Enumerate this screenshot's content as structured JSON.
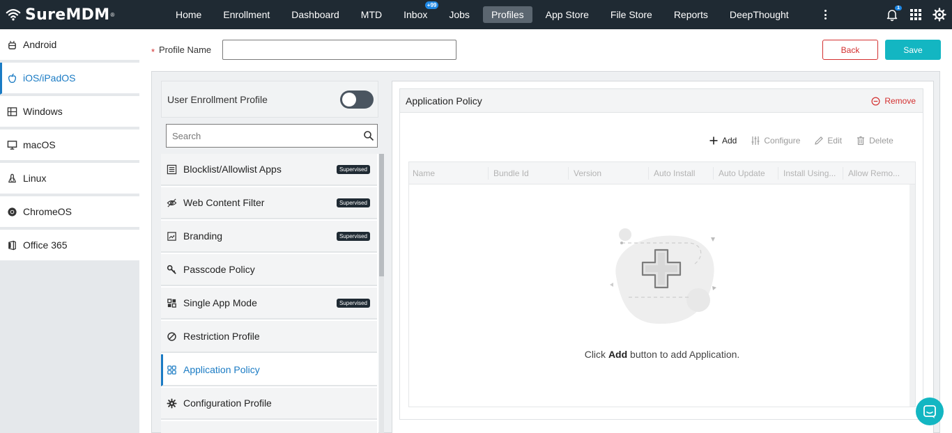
{
  "app": {
    "logo": "SureMDM",
    "logo_mark": "®"
  },
  "nav": {
    "items": [
      {
        "label": "Home"
      },
      {
        "label": "Enrollment"
      },
      {
        "label": "Dashboard"
      },
      {
        "label": "MTD"
      },
      {
        "label": "Inbox",
        "badge": "+99"
      },
      {
        "label": "Jobs"
      },
      {
        "label": "Profiles",
        "active": true
      },
      {
        "label": "App Store"
      },
      {
        "label": "File Store"
      },
      {
        "label": "Reports"
      },
      {
        "label": "DeepThought"
      }
    ],
    "notification_count": "1"
  },
  "os_sidebar": {
    "items": [
      {
        "label": "Android",
        "icon": "android-icon"
      },
      {
        "label": "iOS/iPadOS",
        "icon": "apple-icon",
        "active": true
      },
      {
        "label": "Windows",
        "icon": "windows-icon"
      },
      {
        "label": "macOS",
        "icon": "monitor-icon"
      },
      {
        "label": "Linux",
        "icon": "linux-icon"
      },
      {
        "label": "ChromeOS",
        "icon": "chrome-icon"
      },
      {
        "label": "Office 365",
        "icon": "office-icon"
      }
    ]
  },
  "profile": {
    "required_mark": "*",
    "name_label": "Profile Name",
    "name_value": ""
  },
  "buttons": {
    "back": "Back",
    "save": "Save"
  },
  "panel": {
    "toggle_label": "User Enrollment Profile",
    "toggle_on": false,
    "search_placeholder": "Search",
    "items": [
      {
        "label": "Blocklist/Allowlist Apps",
        "badge": "Supervised",
        "icon": "list-icon"
      },
      {
        "label": "Web Content Filter",
        "badge": "Supervised",
        "icon": "eye-off-icon"
      },
      {
        "label": "Branding",
        "badge": "Supervised",
        "icon": "image-icon"
      },
      {
        "label": "Passcode Policy",
        "badge": "",
        "icon": "key-icon"
      },
      {
        "label": "Single App Mode",
        "badge": "Supervised",
        "icon": "grid-icon"
      },
      {
        "label": "Restriction Profile",
        "badge": "",
        "icon": "block-icon"
      },
      {
        "label": "Application Policy",
        "badge": "",
        "icon": "apps-icon",
        "active": true
      },
      {
        "label": "Configuration Profile",
        "badge": "",
        "icon": "gear-icon"
      }
    ]
  },
  "app_policy": {
    "title": "Application Policy",
    "remove": "Remove",
    "actions": {
      "add": "Add",
      "configure": "Configure",
      "edit": "Edit",
      "delete": "Delete"
    },
    "columns": [
      "Name",
      "Bundle Id",
      "Version",
      "Auto Install",
      "Auto Update",
      "Install Using...",
      "Allow Remo..."
    ],
    "empty_prefix": "Click",
    "empty_bold": "Add",
    "empty_suffix": "button to add Application."
  },
  "colors": {
    "topbar": "#1f2a33",
    "accent": "#1a7bc4",
    "save": "#13b6c2",
    "danger": "#d32f2f"
  }
}
